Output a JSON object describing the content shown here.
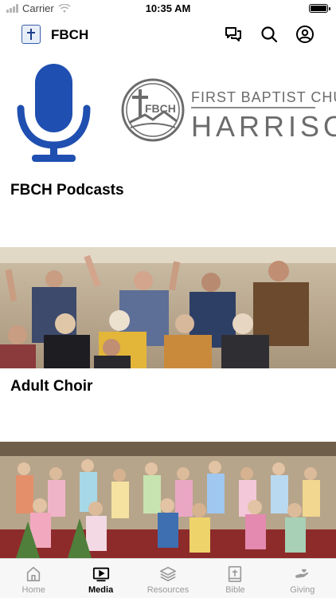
{
  "status_bar": {
    "carrier": "Carrier",
    "time": "10:35 AM"
  },
  "header": {
    "title": "FBCH",
    "icons": [
      "chat-icon",
      "search-icon",
      "profile-icon"
    ]
  },
  "cards": [
    {
      "title": "FBCH Podcasts",
      "banner": {
        "logo_mark": "FBCH",
        "line1": "FIRST BAPTIST CHURCH",
        "line2": "HARRISON"
      }
    },
    {
      "title": "Adult Choir"
    },
    {
      "title": ""
    }
  ],
  "tabs": [
    {
      "label": "Home",
      "icon": "home-icon",
      "active": false
    },
    {
      "label": "Media",
      "icon": "media-icon",
      "active": true
    },
    {
      "label": "Resources",
      "icon": "layers-icon",
      "active": false
    },
    {
      "label": "Bible",
      "icon": "bible-icon",
      "active": false
    },
    {
      "label": "Giving",
      "icon": "giving-icon",
      "active": false
    }
  ],
  "colors": {
    "mic_blue": "#1f4fb0",
    "logo_gray": "#6c6c6c",
    "tab_active": "#000000",
    "tab_inactive": "#9a9a9a"
  }
}
